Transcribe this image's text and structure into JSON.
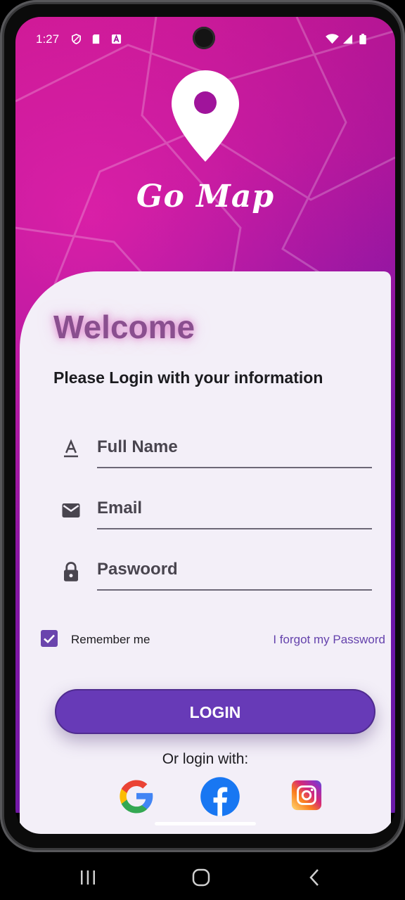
{
  "status_bar": {
    "time": "1:27",
    "left_icons": [
      "shield-icon",
      "sd-card-icon",
      "a-box-icon"
    ],
    "right_icons": [
      "wifi-icon",
      "signal-icon",
      "battery-icon"
    ]
  },
  "brand": {
    "name": "Go Map",
    "logo": "location-pin-icon"
  },
  "login": {
    "welcome": "Welcome",
    "subtitle": "Please Login with your information",
    "fields": [
      {
        "icon": "text-format-icon",
        "label": "Full Name"
      },
      {
        "icon": "mail-icon",
        "label": "Email"
      },
      {
        "icon": "lock-icon",
        "label": "Paswoord"
      }
    ],
    "remember_label": "Remember me",
    "remember_checked": true,
    "forgot_label": "I forgot my Password",
    "button_label": "LOGIN",
    "or_label": "Or login with:",
    "social": [
      "google-icon",
      "facebook-icon",
      "instagram-icon"
    ]
  },
  "colors": {
    "accent": "#673ab7",
    "hero": "#a0149b",
    "card": "#f3eff8",
    "welcome": "#8a4f8f"
  },
  "nav": [
    "recents-icon",
    "home-icon",
    "back-icon"
  ]
}
